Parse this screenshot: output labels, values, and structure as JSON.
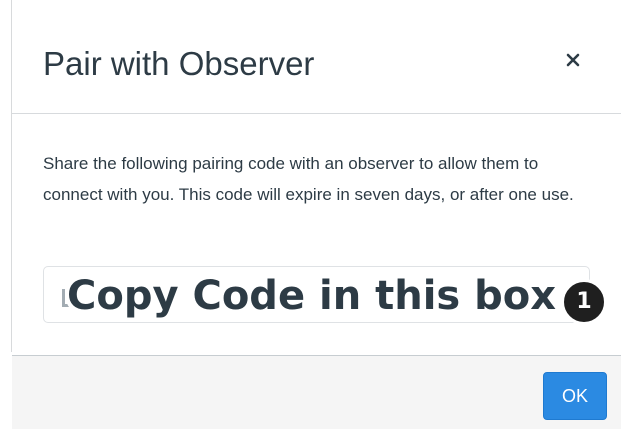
{
  "dialog": {
    "title": "Pair with Observer",
    "close_icon": "close-icon",
    "description": "Share the following pairing code with an observer to allow them to connect with you. This code will expire in seven days, or after one use.",
    "pairing_code": {
      "annotation_text": "Copy Code in this box",
      "step_number": "1"
    },
    "footer": {
      "ok_label": "OK"
    }
  },
  "colors": {
    "text": "#2d3b45",
    "primary_button": "#2b8ae2",
    "footer_bg": "#f5f5f5",
    "badge_bg": "#1f1f1f"
  }
}
